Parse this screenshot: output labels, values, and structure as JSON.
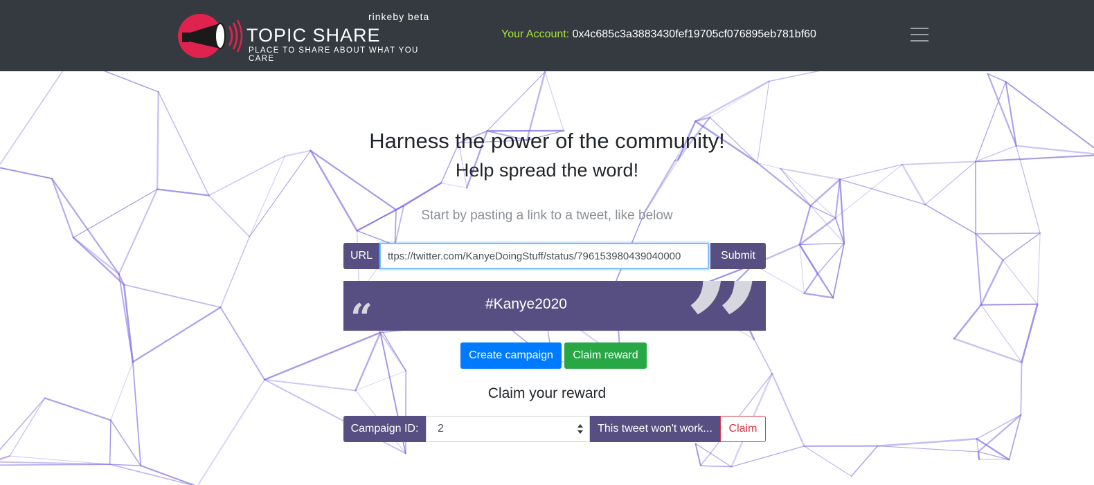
{
  "header": {
    "beta_label": "rinkeby beta",
    "title": "TOPIC SHARE",
    "tagline": "PLACE TO SHARE ABOUT WHAT YOU CARE",
    "account_label": "Your Account:",
    "account_address": "0x4c685c3a3883430fef19705cf076895eb781bf60",
    "menu_icon": "hamburger-icon"
  },
  "hero": {
    "heading": "Harness the power of the community!",
    "subheading": "Help spread the word!",
    "lead": "Start by pasting a link to a tweet, like below"
  },
  "url_form": {
    "prefix_label": "URL",
    "value": "ttps://twitter.com/KanyeDoingStuff/status/796153980439040000",
    "submit_label": "Submit"
  },
  "quote": {
    "open_mark": "“",
    "close_mark": "”",
    "text": "#Kanye2020"
  },
  "actions": {
    "create_label": "Create campaign",
    "claim_reward_label": "Claim reward"
  },
  "claim": {
    "heading": "Claim your reward",
    "campaign_label": "Campaign ID:",
    "campaign_value": "2",
    "status_label": "This tweet won't work...",
    "claim_label": "Claim"
  },
  "colors": {
    "navbar": "#343a40",
    "accent_purple": "#574f82",
    "account_green": "#a8e63a",
    "primary": "#007bff",
    "success": "#28a745",
    "danger": "#dc3545",
    "logo_red": "#e0234e"
  }
}
